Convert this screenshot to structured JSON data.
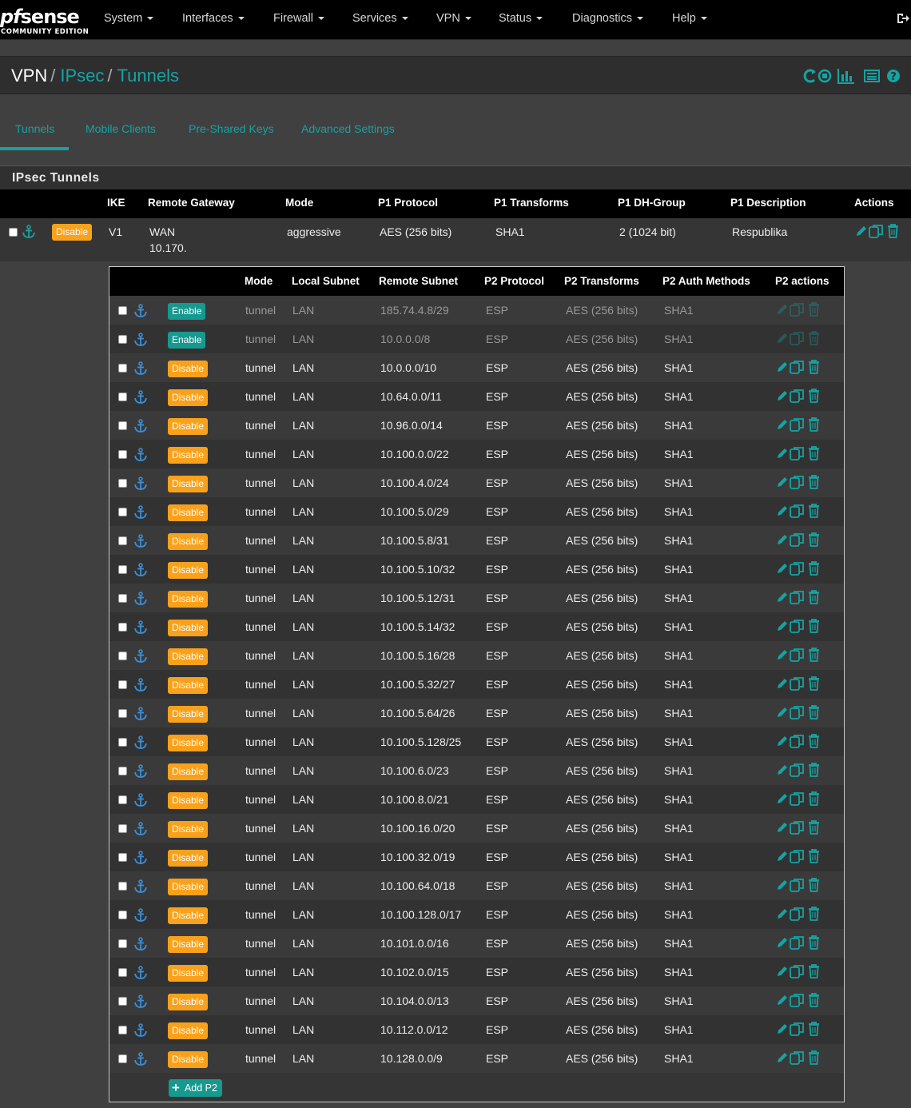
{
  "brand": {
    "main_pf": "pf",
    "main_rest": "sense",
    "sub": "COMMUNITY EDITION"
  },
  "nav": [
    "System",
    "Interfaces",
    "Firewall",
    "Services",
    "VPN",
    "Status",
    "Diagnostics",
    "Help"
  ],
  "breadcrumb": {
    "root": "VPN",
    "sep": "/",
    "level1": "IPsec",
    "level2": "Tunnels"
  },
  "tabs": [
    "Tunnels",
    "Mobile Clients",
    "Pre-Shared Keys",
    "Advanced Settings"
  ],
  "panel_title": "IPsec Tunnels",
  "p1_headers": {
    "ike": "IKE",
    "gateway": "Remote Gateway",
    "mode": "Mode",
    "protocol": "P1 Protocol",
    "transforms": "P1 Transforms",
    "dh": "P1 DH-Group",
    "desc": "P1 Description",
    "actions": "Actions"
  },
  "p1": {
    "toggle_label": "Disable",
    "ike": "V1",
    "gateway_if": "WAN",
    "gateway_ip": "10.170.",
    "mode": "aggressive",
    "protocol": "AES (256 bits)",
    "transforms": "SHA1",
    "dh": "2 (1024 bit)",
    "desc": "Respublika"
  },
  "p2_headers": {
    "mode": "Mode",
    "local": "Local Subnet",
    "remote": "Remote Subnet",
    "protocol": "P2 Protocol",
    "transforms": "P2 Transforms",
    "auth": "P2 Auth Methods",
    "actions": "P2 actions"
  },
  "p2_defaults": {
    "mode": "tunnel",
    "local": "LAN",
    "protocol": "ESP",
    "transforms": "AES (256 bits)",
    "auth": "SHA1"
  },
  "p2": [
    {
      "toggle": "Enable",
      "remote": "185.74.4.8/29",
      "disabled": true
    },
    {
      "toggle": "Enable",
      "remote": "10.0.0.0/8",
      "disabled": true
    },
    {
      "toggle": "Disable",
      "remote": "10.0.0.0/10",
      "disabled": false
    },
    {
      "toggle": "Disable",
      "remote": "10.64.0.0/11",
      "disabled": false
    },
    {
      "toggle": "Disable",
      "remote": "10.96.0.0/14",
      "disabled": false
    },
    {
      "toggle": "Disable",
      "remote": "10.100.0.0/22",
      "disabled": false
    },
    {
      "toggle": "Disable",
      "remote": "10.100.4.0/24",
      "disabled": false
    },
    {
      "toggle": "Disable",
      "remote": "10.100.5.0/29",
      "disabled": false
    },
    {
      "toggle": "Disable",
      "remote": "10.100.5.8/31",
      "disabled": false
    },
    {
      "toggle": "Disable",
      "remote": "10.100.5.10/32",
      "disabled": false
    },
    {
      "toggle": "Disable",
      "remote": "10.100.5.12/31",
      "disabled": false
    },
    {
      "toggle": "Disable",
      "remote": "10.100.5.14/32",
      "disabled": false
    },
    {
      "toggle": "Disable",
      "remote": "10.100.5.16/28",
      "disabled": false
    },
    {
      "toggle": "Disable",
      "remote": "10.100.5.32/27",
      "disabled": false
    },
    {
      "toggle": "Disable",
      "remote": "10.100.5.64/26",
      "disabled": false
    },
    {
      "toggle": "Disable",
      "remote": "10.100.5.128/25",
      "disabled": false
    },
    {
      "toggle": "Disable",
      "remote": "10.100.6.0/23",
      "disabled": false
    },
    {
      "toggle": "Disable",
      "remote": "10.100.8.0/21",
      "disabled": false
    },
    {
      "toggle": "Disable",
      "remote": "10.100.16.0/20",
      "disabled": false
    },
    {
      "toggle": "Disable",
      "remote": "10.100.32.0/19",
      "disabled": false
    },
    {
      "toggle": "Disable",
      "remote": "10.100.64.0/18",
      "disabled": false
    },
    {
      "toggle": "Disable",
      "remote": "10.100.128.0/17",
      "disabled": false
    },
    {
      "toggle": "Disable",
      "remote": "10.101.0.0/16",
      "disabled": false
    },
    {
      "toggle": "Disable",
      "remote": "10.102.0.0/15",
      "disabled": false
    },
    {
      "toggle": "Disable",
      "remote": "10.104.0.0/13",
      "disabled": false
    },
    {
      "toggle": "Disable",
      "remote": "10.112.0.0/12",
      "disabled": false
    },
    {
      "toggle": "Disable",
      "remote": "10.128.0.0/9",
      "disabled": false
    }
  ],
  "add_p2_label": "Add P2",
  "icons": [
    "logout-icon",
    "restart-service-icon",
    "status-chart-icon",
    "log-icon",
    "help-icon",
    "anchor-icon",
    "edit-icon",
    "copy-icon",
    "delete-icon"
  ],
  "colors": {
    "accent": "#16a3a3",
    "enable": "#16998f",
    "disable": "#f9a11b",
    "background": "#404040"
  }
}
